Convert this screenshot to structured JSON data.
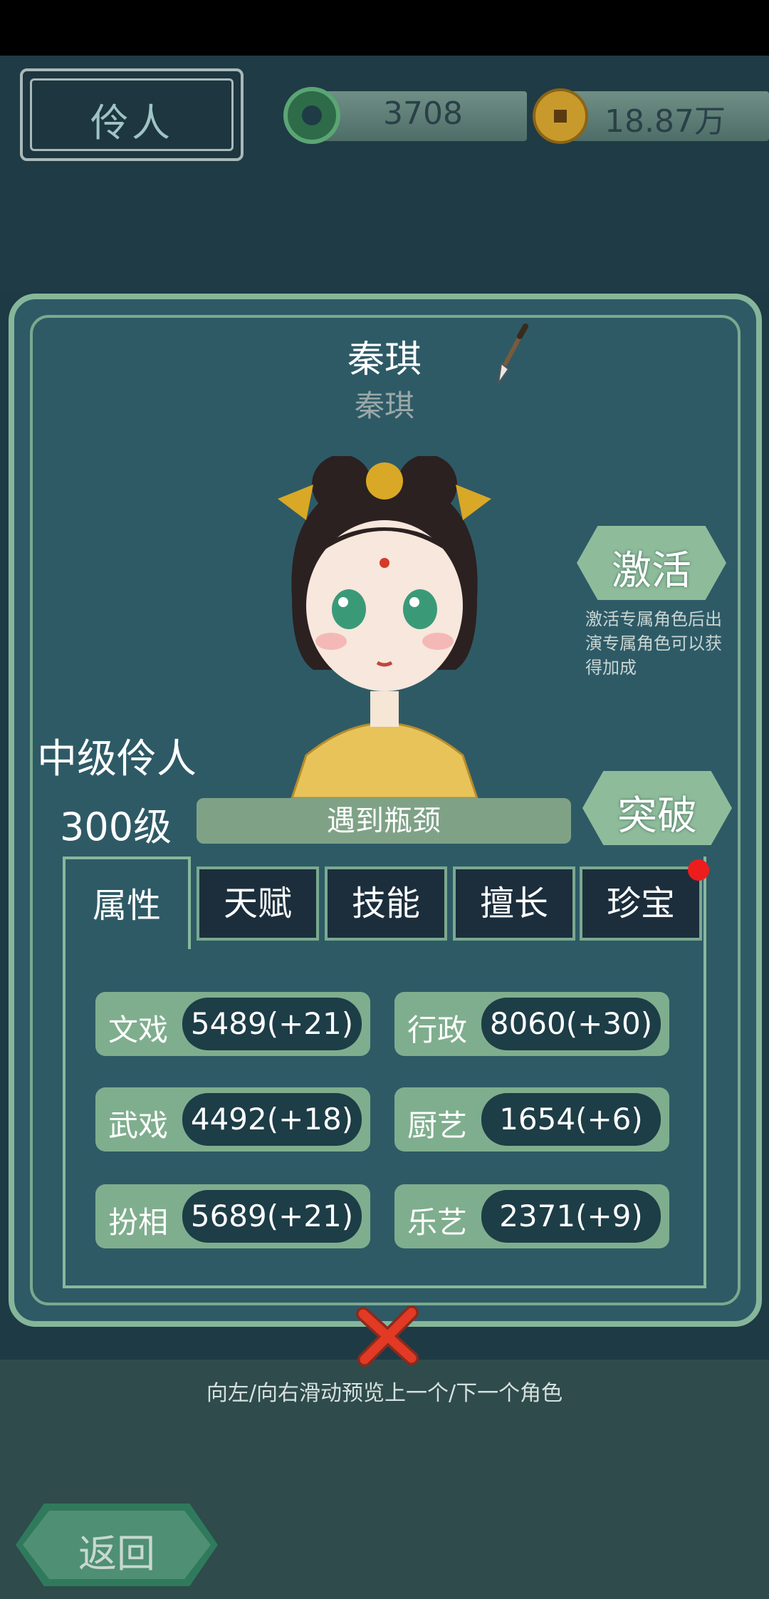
{
  "header": {
    "title": "伶人"
  },
  "currencies": {
    "jade": "3708",
    "coins": "18.87万"
  },
  "character": {
    "name": "秦琪",
    "subname": "秦琪",
    "rank": "中级伶人",
    "level": "300级",
    "status": "遇到瓶颈"
  },
  "actions": {
    "activate_label": "激活",
    "activate_desc": "激活专属角色后出演专属角色可以获得加成",
    "breakthrough_label": "突破"
  },
  "tabs": [
    "属性",
    "天赋",
    "技能",
    "擅长",
    "珍宝"
  ],
  "stats": [
    {
      "label": "文戏",
      "value": "5489(+21)"
    },
    {
      "label": "行政",
      "value": "8060(+30)"
    },
    {
      "label": "武戏",
      "value": "4492(+18)"
    },
    {
      "label": "厨艺",
      "value": "1654(+6)"
    },
    {
      "label": "扮相",
      "value": "5689(+21)"
    },
    {
      "label": "乐艺",
      "value": "2371(+9)"
    }
  ],
  "footer": {
    "hint": "向左/向右滑动预览上一个/下一个角色",
    "back_label": "返回"
  },
  "colors": {
    "accent": "#8ebc9b",
    "panel": "#2e5a66",
    "notification": "#ee1d1d"
  }
}
